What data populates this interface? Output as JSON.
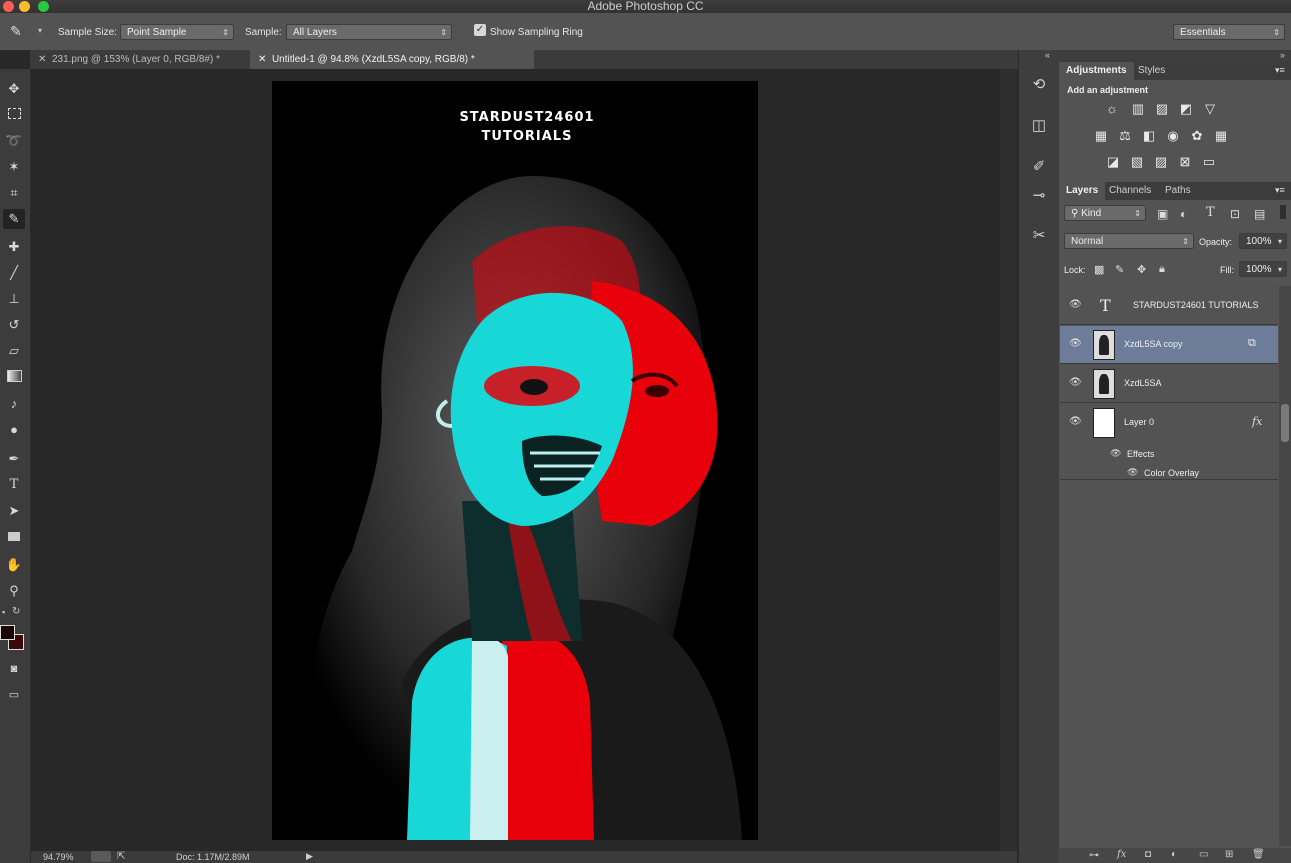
{
  "app": {
    "title": "Adobe Photoshop CC"
  },
  "options_bar": {
    "sample_size_label": "Sample Size:",
    "sample_size_value": "Point Sample",
    "sample_label": "Sample:",
    "sample_value": "All Layers",
    "show_ring_label": "Show Sampling Ring",
    "workspace": "Essentials"
  },
  "doc_tabs": [
    {
      "label": "231.png @ 153% (Layer 0, RGB/8#) *"
    },
    {
      "label": "Untitled-1 @ 94.8% (XzdL5SA copy, RGB/8) *"
    }
  ],
  "canvas": {
    "line1": "STARDUST24601",
    "line2": "TUTORIALS"
  },
  "status": {
    "zoom": "94.79%",
    "doc": "Doc: 1.17M/2.89M"
  },
  "adjustments_panel": {
    "tabs": [
      "Adjustments",
      "Styles"
    ],
    "heading": "Add an adjustment"
  },
  "layers_panel": {
    "tabs": [
      "Layers",
      "Channels",
      "Paths"
    ],
    "filter_kind": "Kind",
    "blend_mode": "Normal",
    "opacity_label": "Opacity:",
    "opacity_value": "100%",
    "lock_label": "Lock:",
    "fill_label": "Fill:",
    "fill_value": "100%",
    "layers": [
      {
        "name": "STARDUST24601 TUTORIALS"
      },
      {
        "name": "XzdL5SA copy"
      },
      {
        "name": "XzdL5SA"
      },
      {
        "name": "Layer 0"
      }
    ],
    "effects_label": "Effects",
    "effect_item": "Color Overlay"
  },
  "colors": {
    "accent_selected_layer": "#6d7d99",
    "red_channel": "#e8000b",
    "cyan_channel": "#18d7d7"
  }
}
